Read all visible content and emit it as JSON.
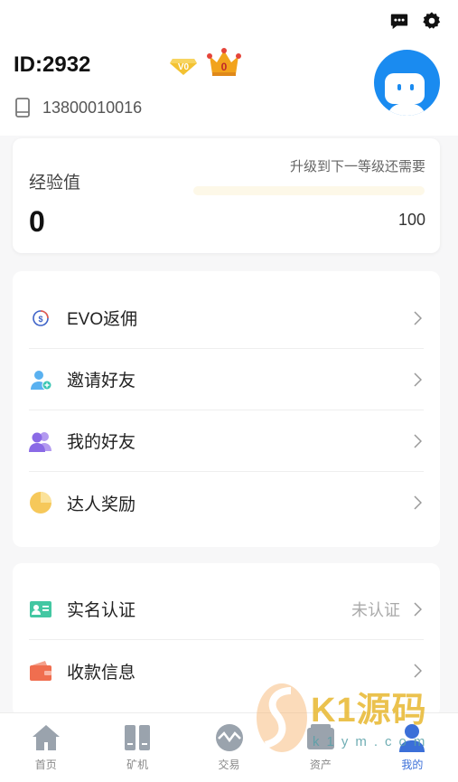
{
  "header": {
    "user_id": "ID:2932",
    "phone": "13800010016",
    "level_badge": "V0",
    "crown_level": "0"
  },
  "experience": {
    "label": "经验值",
    "value": "0",
    "hint": "升级到下一等级还需要",
    "required": "100",
    "progress": 0
  },
  "menu_group_1": [
    {
      "icon": "evo-icon",
      "label": "EVO返佣"
    },
    {
      "icon": "invite-user-icon",
      "label": "邀请好友"
    },
    {
      "icon": "friends-icon",
      "label": "我的好友"
    },
    {
      "icon": "pie-chart-icon",
      "label": "达人奖励"
    }
  ],
  "menu_group_2": [
    {
      "icon": "id-card-icon",
      "label": "实名认证",
      "value": "未认证"
    },
    {
      "icon": "wallet-icon",
      "label": "收款信息"
    }
  ],
  "tabbar": [
    {
      "icon": "home-icon",
      "label": "首页"
    },
    {
      "icon": "miner-icon",
      "label": "矿机"
    },
    {
      "icon": "trade-icon",
      "label": "交易"
    },
    {
      "icon": "assets-icon",
      "label": "资产"
    },
    {
      "icon": "profile-icon",
      "label": "我的",
      "active": true
    }
  ],
  "watermark": {
    "brand": "K1源码",
    "domain": "k1ym.com"
  },
  "colors": {
    "accent_blue": "#1a8bf0",
    "active_tab": "#3b6fd8",
    "gold": "#f5c542"
  }
}
